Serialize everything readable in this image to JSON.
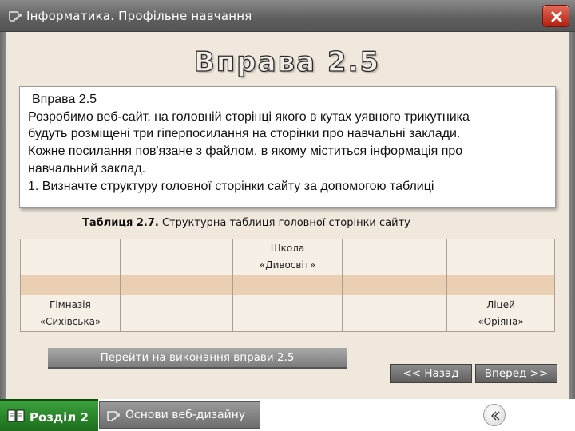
{
  "window": {
    "title": "Інформатика. Профільне навчання",
    "title_icon": "hand-pointer-icon",
    "close_icon": "close-icon",
    "accent_color": "#c0301c"
  },
  "exercise": {
    "heading": "Вправа 2.5",
    "box_title": "Вправа 2.5",
    "lines": [
      "Розробимо веб-сайт, на головній сторінці якого в кутах уявного трикутника",
      "будуть розміщені три гіперпосилання на сторінки про навчальні заклади.",
      "Кожне посилання пов'язане з файлом, в якому міститься інформація про",
      "навчальний заклад.",
      "1. Визначте структуру головної сторінки сайту за допомогою таблиці"
    ]
  },
  "table": {
    "caption_bold": "Таблиця 2.7.",
    "caption_text": " Структурна таблиця головної сторінки сайту",
    "school_line1": "Школа",
    "school_line2": "«Дивосвіт»",
    "gymnasium_line1": "Гімназія",
    "gymnasium_line2": "«Сихівська»",
    "lyceum_line1": "Ліцей",
    "lyceum_line2": "«Оріяна»",
    "band_color": "#eacfb3"
  },
  "actions": {
    "go_exercise": "Перейти на виконання вправи 2.5",
    "back": "<< Назад",
    "forward": "Вперед >>"
  },
  "footer": {
    "section_label": "Розділ 2",
    "section_icon": "book-icon",
    "topic_label": "Основи веб-дизайну",
    "topic_icon": "hand-pointer-icon",
    "back_icon": "chevron-left-icon",
    "section_color": "#2e8b2e"
  }
}
